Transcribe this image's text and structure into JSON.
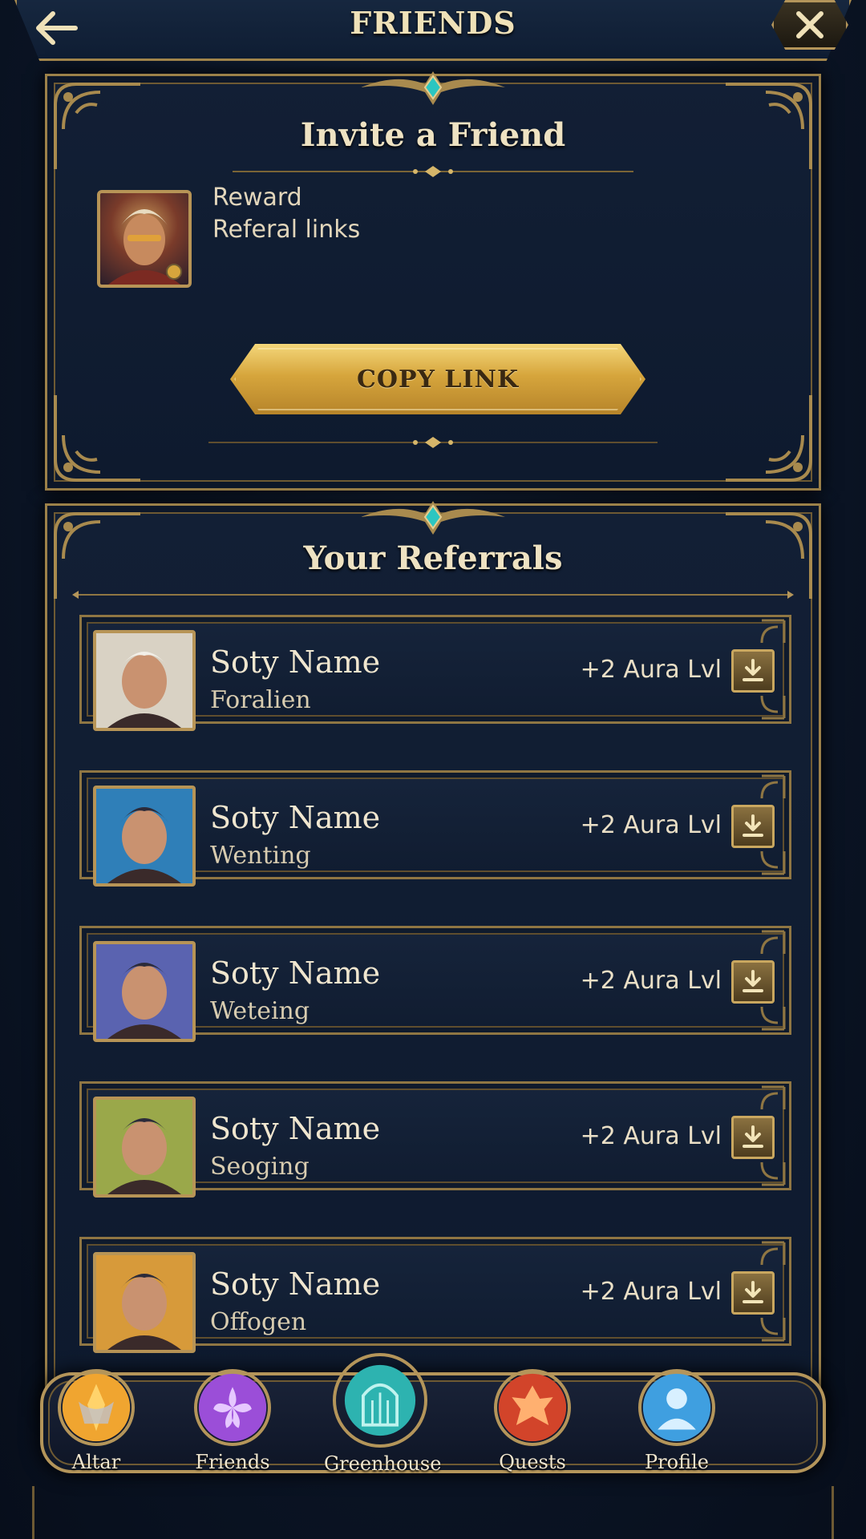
{
  "header": {
    "title": "FRIENDS"
  },
  "invite": {
    "title": "Invite a Friend",
    "reward_line1": "Reward",
    "reward_line2": "Referal links",
    "button_label": "COPY LINK"
  },
  "referrals": {
    "title": "Your Referrals",
    "items": [
      {
        "name": "Soty Name",
        "sub": "Foralien",
        "bonus": "+2 Aura Lvl",
        "avatar_color": "#d9d2c4"
      },
      {
        "name": "Soty Name",
        "sub": "Wenting",
        "bonus": "+2 Aura Lvl",
        "avatar_color": "#2f7fb8"
      },
      {
        "name": "Soty Name",
        "sub": "Weteing",
        "bonus": "+2 Aura Lvl",
        "avatar_color": "#5a63b0"
      },
      {
        "name": "Soty Name",
        "sub": "Seoging",
        "bonus": "+2 Aura Lvl",
        "avatar_color": "#9aa84a"
      },
      {
        "name": "Soty Name",
        "sub": "Offogen",
        "bonus": "+2 Aura Lvl",
        "avatar_color": "#d79a3a"
      }
    ]
  },
  "nav": {
    "items": [
      {
        "label": "Altar",
        "icon": "altar-icon",
        "color": "#f0a530"
      },
      {
        "label": "Friends",
        "icon": "friends-icon",
        "color": "#9b4ed8"
      },
      {
        "label": "Greenhouse",
        "icon": "greenhouse-icon",
        "color": "#2db3b0"
      },
      {
        "label": "Quests",
        "icon": "quests-icon",
        "color": "#d2442a"
      },
      {
        "label": "Profile",
        "icon": "profile-icon",
        "color": "#3f9fe0"
      }
    ]
  },
  "colors": {
    "gold": "#b4955a",
    "panel": "#121f35",
    "button_gold": "#d6a53c"
  }
}
